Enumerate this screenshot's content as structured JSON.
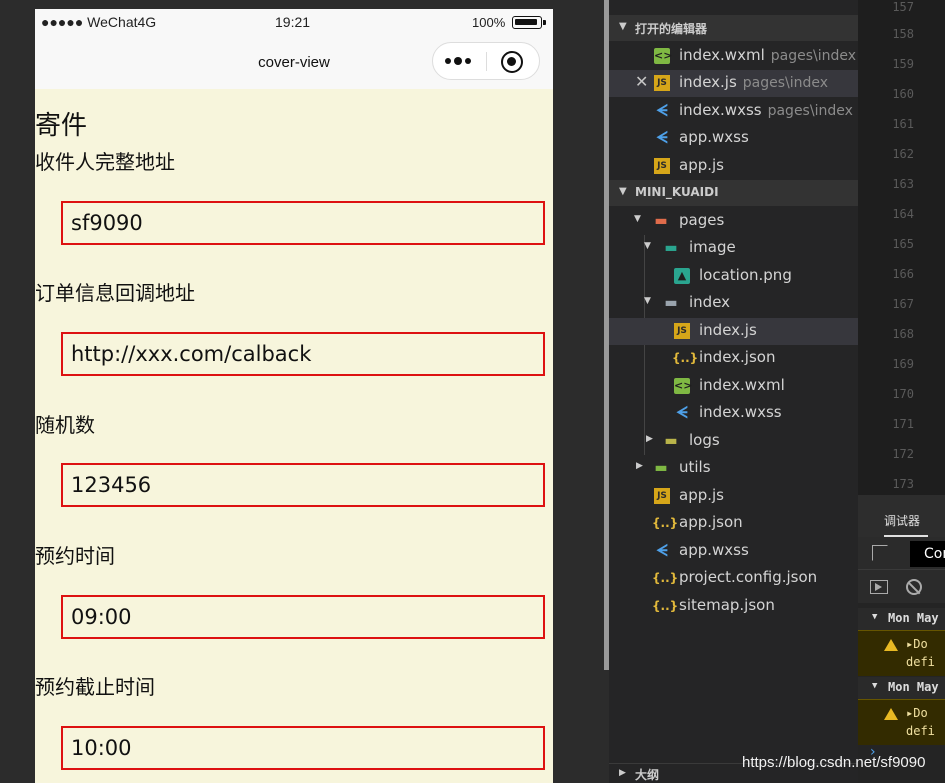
{
  "phone": {
    "status": {
      "carrier": "●●●●● WeChat4G",
      "time": "19:21",
      "battery": "100%"
    },
    "nav": {
      "title": "cover-view"
    },
    "heading": "寄件",
    "fields": [
      {
        "label": "收件人完整地址",
        "value": "sf9090"
      },
      {
        "label": "订单信息回调地址",
        "value": "http://xxx.com/calback"
      },
      {
        "label": "随机数",
        "value": "123456"
      },
      {
        "label": "预约时间",
        "value": "09:00"
      },
      {
        "label": "预约截止时间",
        "value": "10:00"
      }
    ]
  },
  "explorer": {
    "open_editors_title": "打开的编辑器",
    "open_editors": [
      {
        "name": "index.wxml",
        "path": "pages\\index",
        "icon": "wxml-file-icon"
      },
      {
        "name": "index.js",
        "path": "pages\\index",
        "icon": "js-file-icon"
      },
      {
        "name": "index.wxss",
        "path": "pages\\index",
        "icon": "css-file-icon"
      },
      {
        "name": "app.wxss",
        "path": "",
        "icon": "css-file-icon"
      },
      {
        "name": "app.js",
        "path": "",
        "icon": "js-file-icon"
      }
    ],
    "project_title": "MINI_KUAIDI",
    "tree": [
      {
        "name": "pages",
        "icon": "folder-icon"
      },
      {
        "name": "image",
        "icon": "folder-icon"
      },
      {
        "name": "location.png",
        "icon": "image-file-icon"
      },
      {
        "name": "index",
        "icon": "folder-icon"
      },
      {
        "name": "index.js",
        "icon": "js-file-icon"
      },
      {
        "name": "index.json",
        "icon": "json-file-icon"
      },
      {
        "name": "index.wxml",
        "icon": "wxml-file-icon"
      },
      {
        "name": "index.wxss",
        "icon": "css-file-icon"
      },
      {
        "name": "logs",
        "icon": "folder-icon"
      },
      {
        "name": "utils",
        "icon": "folder-icon"
      },
      {
        "name": "app.js",
        "icon": "js-file-icon"
      },
      {
        "name": "app.json",
        "icon": "json-file-icon"
      },
      {
        "name": "app.wxss",
        "icon": "css-file-icon"
      },
      {
        "name": "project.config.json",
        "icon": "json-file-icon"
      },
      {
        "name": "sitemap.json",
        "icon": "json-file-icon"
      }
    ],
    "outline_title": "大纲"
  },
  "editor": {
    "line_numbers": [
      "157",
      "158",
      "159",
      "160",
      "161",
      "162",
      "163",
      "164",
      "165",
      "166",
      "167",
      "168",
      "169",
      "170",
      "171",
      "172",
      "173"
    ]
  },
  "debugger": {
    "tab": "调试器",
    "console_tab": "Con",
    "groups": [
      {
        "title": "Mon May",
        "warn_line1": "Do",
        "warn_line2": "defi"
      },
      {
        "title": "Mon May",
        "warn_line1": "Do",
        "warn_line2": "defi"
      }
    ]
  },
  "watermark": "https://blog.csdn.net/sf9090"
}
